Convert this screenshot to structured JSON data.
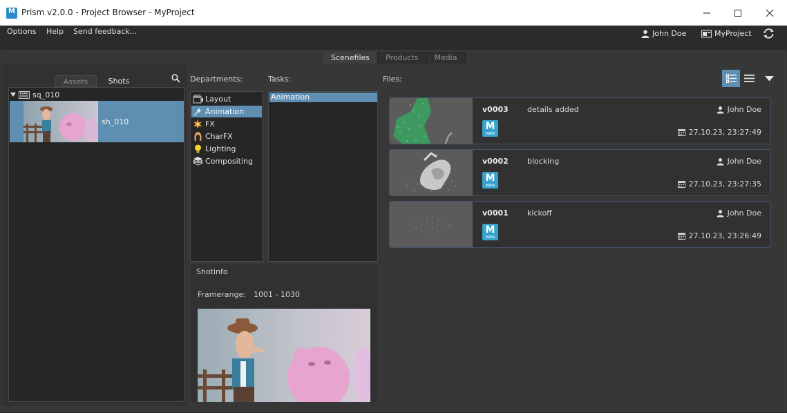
{
  "window": {
    "title": "Prism v2.0.0 - Project Browser - MyProject",
    "app_icon_letter": "M"
  },
  "menu": {
    "items": [
      "Options",
      "Help",
      "Send feedback..."
    ]
  },
  "user": {
    "name": "John Doe",
    "project": "MyProject"
  },
  "main_tabs": [
    {
      "label": "Scenefiles",
      "active": true
    },
    {
      "label": "Products",
      "active": false
    },
    {
      "label": "Media",
      "active": false
    }
  ],
  "entity_tabs": [
    {
      "label": "Assets",
      "active": false
    },
    {
      "label": "Shots",
      "active": true
    }
  ],
  "tree": {
    "sequence": "sq_010",
    "shot": "sh_010"
  },
  "departments": {
    "label": "Departments:",
    "items": [
      {
        "label": "Layout",
        "icon": "layout-icon"
      },
      {
        "label": "Animation",
        "icon": "animation-icon",
        "selected": true
      },
      {
        "label": "FX",
        "icon": "fx-icon"
      },
      {
        "label": "CharFX",
        "icon": "charfx-icon"
      },
      {
        "label": "Lighting",
        "icon": "lighting-icon"
      },
      {
        "label": "Compositing",
        "icon": "compositing-icon"
      }
    ]
  },
  "tasks": {
    "label": "Tasks:",
    "items": [
      "Animation"
    ]
  },
  "shotinfo": {
    "title": "Shotinfo",
    "framerange_label": "Framerange:",
    "framerange_value": "1001 - 1030"
  },
  "files": {
    "label": "Files:",
    "items": [
      {
        "version": "v0003",
        "comment": "details added",
        "user": "John Doe",
        "date": "27.10.23,  23:27:49",
        "app": "MAYA"
      },
      {
        "version": "v0002",
        "comment": "blocking",
        "user": "John Doe",
        "date": "27.10.23,  23:27:35",
        "app": "MAYA"
      },
      {
        "version": "v0001",
        "comment": "kickoff",
        "user": "John Doe",
        "date": "27.10.23,  23:26:49",
        "app": "MAYA"
      }
    ]
  },
  "colors": {
    "selection": "#5e8fb3",
    "maya": "#37a4cf",
    "background": "#373737"
  }
}
